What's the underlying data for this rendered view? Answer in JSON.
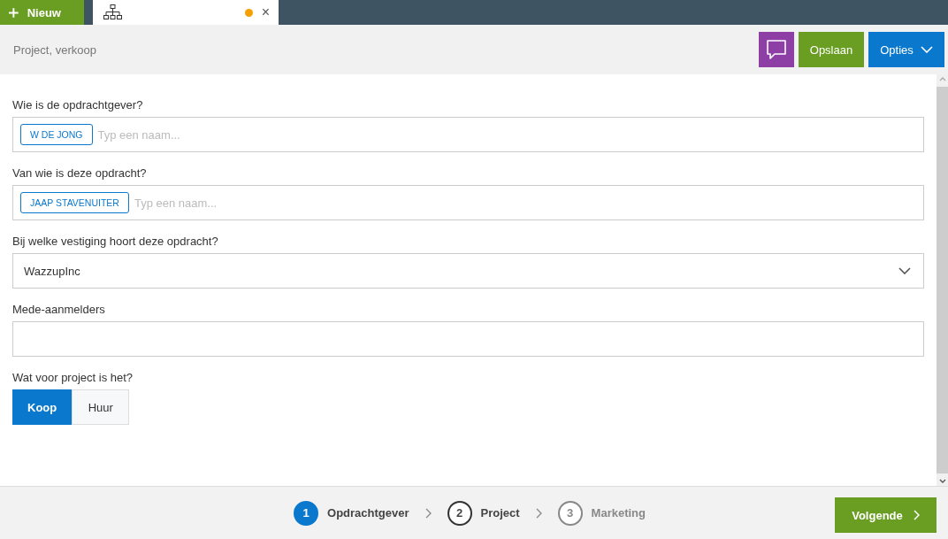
{
  "topbar": {
    "new_button": "Nieuw",
    "tab": {
      "modified": true,
      "close": "×"
    }
  },
  "header": {
    "title": "Project, verkoop",
    "save_button": "Opslaan",
    "options_button": "Opties"
  },
  "form": {
    "fields": [
      {
        "kind": "tags",
        "label": "Wie is de opdrachtgever?",
        "tags": [
          "W DE JONG"
        ],
        "placeholder": "Typ een naam..."
      },
      {
        "kind": "tags",
        "label": "Van wie is deze opdracht?",
        "tags": [
          "JAAP STAVENUITER"
        ],
        "placeholder": "Typ een naam..."
      },
      {
        "kind": "select",
        "label": "Bij welke vestiging hoort deze opdracht?",
        "value": "WazzupInc"
      },
      {
        "kind": "text",
        "label": "Mede-aanmelders"
      },
      {
        "kind": "toggle",
        "label": "Wat voor project is het?",
        "options": [
          {
            "label": "Koop",
            "selected": true
          },
          {
            "label": "Huur",
            "selected": false
          }
        ]
      }
    ]
  },
  "footer": {
    "steps": [
      {
        "number": "1",
        "label": "Opdrachtgever",
        "selected": true,
        "disabled": false
      },
      {
        "number": "2",
        "label": "Project",
        "selected": false,
        "disabled": false
      },
      {
        "number": "3",
        "label": "Marketing",
        "selected": false,
        "disabled": true
      }
    ],
    "next_button": "Volgende"
  }
}
